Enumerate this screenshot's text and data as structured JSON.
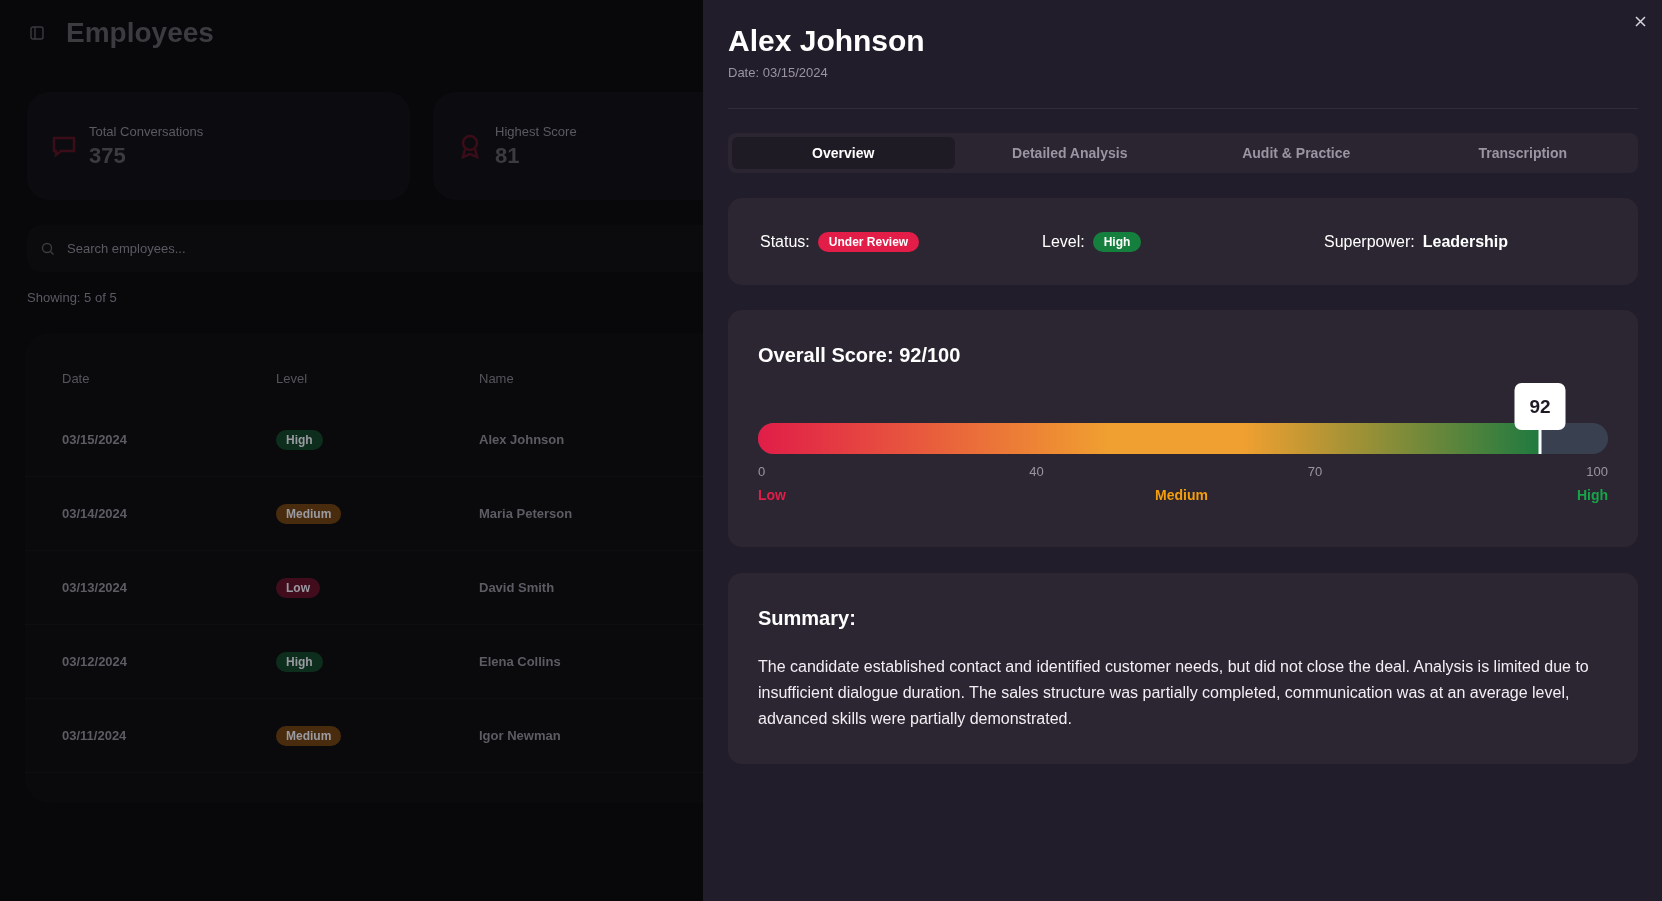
{
  "page": {
    "title": "Employees",
    "stats": [
      {
        "label": "Total Conversations",
        "value": "375",
        "kind": "chat"
      },
      {
        "label": "Highest Score",
        "value": "81",
        "kind": "award"
      }
    ],
    "search": {
      "placeholder": "Search employees..."
    },
    "showing": "Showing: 5 of 5",
    "table": {
      "columns": [
        "Date",
        "Level",
        "Name"
      ],
      "rows": [
        {
          "date": "03/15/2024",
          "level": "High",
          "color": "#0e2e1d",
          "name": "Alex Johnson"
        },
        {
          "date": "03/14/2024",
          "level": "Medium",
          "color": "#492c0d",
          "name": "Maria Peterson"
        },
        {
          "date": "03/13/2024",
          "level": "Low",
          "color": "#410d1d",
          "name": "David Smith"
        },
        {
          "date": "03/12/2024",
          "level": "High",
          "color": "#0e2e1d",
          "name": "Elena Collins"
        },
        {
          "date": "03/11/2024",
          "level": "Medium",
          "color": "#492c0d",
          "name": "Igor Newman"
        }
      ]
    }
  },
  "panel": {
    "title": "Alex Johnson",
    "date": "Date: 03/15/2024",
    "tabs": [
      {
        "label": "Overview",
        "selected": true
      },
      {
        "label": "Detailed Analysis",
        "selected": false
      },
      {
        "label": "Audit & Practice",
        "selected": false
      },
      {
        "label": "Transcription",
        "selected": false
      }
    ],
    "info": [
      {
        "label": "Status:",
        "value": "Under Review",
        "kind": "badge",
        "color": "#e11d48"
      },
      {
        "label": "Level:",
        "value": "High",
        "kind": "badge",
        "color": "#15803d"
      },
      {
        "label": "Superpower:",
        "value": "Leadership",
        "kind": "text"
      }
    ],
    "score": {
      "title": "Overall Score: 92/100",
      "level": 0.92,
      "marker": "92",
      "ticks": [
        "0",
        "40",
        "70",
        "100"
      ],
      "zones": [
        {
          "label": "Low",
          "color": "#e11d48"
        },
        {
          "label": "Medium",
          "color": "#f59e0b"
        },
        {
          "label": "High",
          "color": "#16a34a"
        }
      ]
    },
    "summary": {
      "title": "Summary:",
      "text": "The candidate established contact and identified customer needs, but did not close the deal. Analysis is limited due to insufficient dialogue duration. The sales structure was partially completed, communication was at an average level, advanced skills were partially demonstrated."
    }
  }
}
